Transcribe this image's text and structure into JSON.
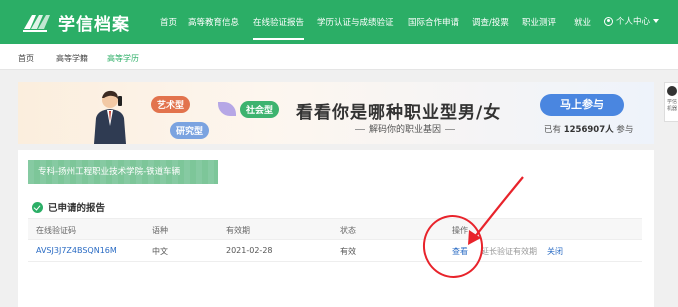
{
  "header": {
    "logo_text": "学信档案",
    "nav": [
      "首页",
      "高等教育信息",
      "在线验证报告",
      "学历认证与成绩验证",
      "国际合作申请",
      "调查/投票",
      "职业测评",
      "就业"
    ],
    "active_nav_index": 2,
    "user_menu": "个人中心",
    "brand_color": "#2bae66"
  },
  "subnav": {
    "items": [
      "首页",
      "高等学籍",
      "高等学历"
    ],
    "active_index": 2
  },
  "banner": {
    "tags": {
      "art": "艺术型",
      "research": "研究型",
      "social": "社会型"
    },
    "title": "看看你是哪种职业型男/女",
    "subtitle": "解码你的职业基因",
    "join_button": "马上参与",
    "count_prefix": "已有",
    "count": "1256907人",
    "count_suffix": "参与"
  },
  "side_widget": {
    "text": "学信 机器"
  },
  "school_tab": "专科-扬州工程职业技术学院-铁道车辆",
  "report_section": {
    "title": "已申请的报告",
    "columns": [
      "在线验证码",
      "语种",
      "有效期",
      "状态",
      "操作"
    ],
    "rows": [
      {
        "code": "AVSJ3J7Z4BSQN16M",
        "language": "中文",
        "expiry": "2021-02-28",
        "status": "有效",
        "actions": [
          "查看",
          "延长验证有效期",
          "关闭"
        ]
      }
    ]
  },
  "annotation_color": "#e8232b"
}
